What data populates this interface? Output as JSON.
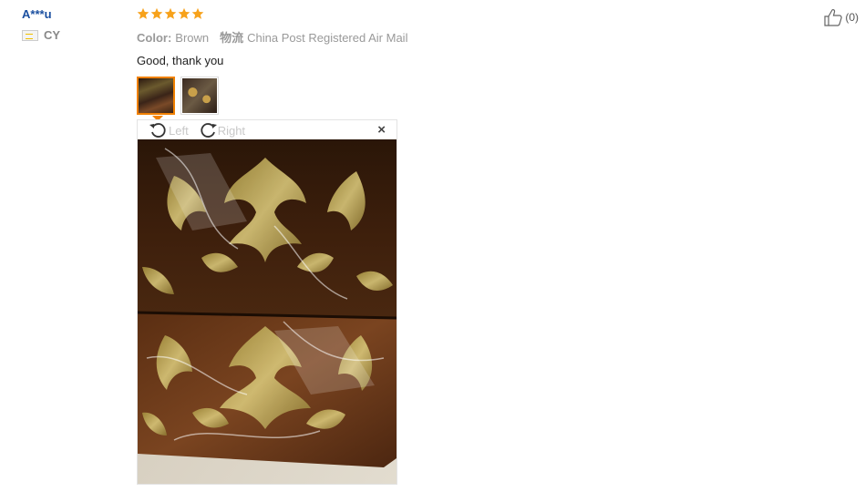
{
  "review": {
    "user_name": "A***u",
    "country": "CY",
    "rating": 5,
    "color_label": "Color:",
    "color_value": "Brown",
    "shipping_label": "物流",
    "shipping_value": "China Post Registered Air Mail",
    "text": "Good, thank you",
    "like_count": "(0)"
  },
  "viewer": {
    "rotate_left": "Left",
    "rotate_right": "Right",
    "close": "×"
  },
  "colors": {
    "star": "#f7a21b",
    "accent": "#f08000",
    "user_link": "#1a4fa0"
  }
}
